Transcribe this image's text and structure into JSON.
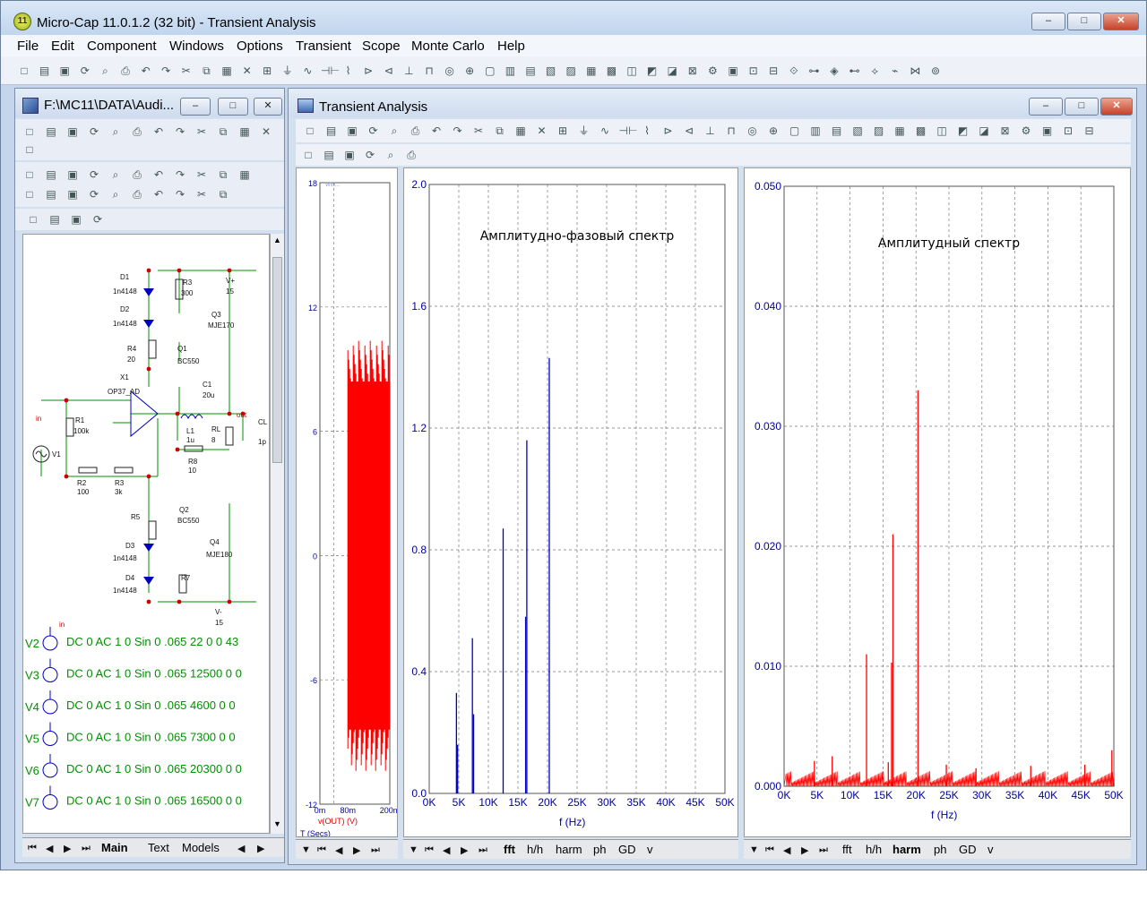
{
  "app": {
    "title": "Micro-Cap 11.0.1.2 (32 bit) - Transient Analysis",
    "icon_text": "11",
    "window_buttons": [
      "–",
      "□",
      "✕"
    ]
  },
  "menu": [
    "File",
    "Edit",
    "Component",
    "Windows",
    "Options",
    "Transient",
    "Scope",
    "Monte Carlo",
    "Help"
  ],
  "schematic_window": {
    "title": "F:\\MC11\\DATA\\Audi...",
    "components": {
      "D1": "D1",
      "D1m": "1n4148",
      "D2": "D2",
      "D2m": "1n4148",
      "R3": "R3",
      "R3v": "300",
      "Q3": "Q3",
      "Q3m": "MJE170",
      "R4": "R4",
      "R4v": "20",
      "Q1": "Q1",
      "Q1m": "BC550",
      "X1": "X1",
      "X1m": "OP37_AD",
      "C1": "C1",
      "C1v": "20u",
      "R1": "R1",
      "R1v": "100k",
      "in": "in",
      "out": "out",
      "L1": "L1",
      "L1v": "1u",
      "RL": "RL",
      "RLv": "8",
      "CL": "CL",
      "CLv": "1p",
      "V1": "V1",
      "R8": "R8",
      "R8v": "10",
      "R2": "R2",
      "R2v": "100",
      "R3b": "R3",
      "R3bv": "3k",
      "Q2": "Q2",
      "Q2m": "BC550",
      "R5": "R5",
      "D3": "D3",
      "D3m": "1n4148",
      "Q4": "Q4",
      "Q4m": "MJE180",
      "D4": "D4",
      "D4m": "1n4148",
      "R7": "R7",
      "Vp": "V+",
      "Vpv": "15",
      "Vm": "V-",
      "Vmv": "15",
      "in2": "in"
    },
    "sources": [
      {
        "name": "V2",
        "spec": "DC 0 AC 1 0 Sin 0 .065 22 0 0 43"
      },
      {
        "name": "V3",
        "spec": "DC 0 AC 1 0 Sin 0 .065 12500 0 0"
      },
      {
        "name": "V4",
        "spec": "DC 0 AC 1 0 Sin 0 .065 4600 0 0"
      },
      {
        "name": "V5",
        "spec": "DC 0 AC 1 0 Sin 0 .065 7300 0 0"
      },
      {
        "name": "V6",
        "spec": "DC 0 AC 1 0 Sin 0 .065 20300 0 0"
      },
      {
        "name": "V7",
        "spec": "DC 0 AC 1 0 Sin 0 .065 16500 0 0"
      }
    ],
    "tabs": [
      "Main",
      "Text",
      "Models"
    ],
    "active_tab": "Main"
  },
  "transient_window": {
    "title": "Transient Analysis",
    "panels": [
      {
        "tabs": []
      },
      {
        "tabs": [
          "fft",
          "h/h",
          "harm",
          "ph",
          "GD",
          "v"
        ],
        "active_tab": "fft"
      },
      {
        "tabs": [
          "fft",
          "h/h",
          "harm",
          "ph",
          "GD",
          "v"
        ],
        "active_tab": "harm"
      }
    ]
  },
  "chart_data": [
    {
      "type": "line",
      "title": "",
      "xlabel": "T (Secs)",
      "ylabel": "v(OUT) (V)",
      "x_ticks": [
        "0m",
        "80m",
        "200m"
      ],
      "y_ticks": [
        "18",
        "12",
        "6",
        "0",
        "-6",
        "-12"
      ],
      "xlim": [
        0,
        0.2
      ],
      "ylim": [
        -12,
        18
      ],
      "series": [
        {
          "color": "#ff0000",
          "envelope": {
            "x_start": 0.08,
            "x_end": 0.2,
            "min": -10.5,
            "max": 10.5
          }
        }
      ],
      "grid": true,
      "extra_label": "WW..."
    },
    {
      "type": "bar",
      "title": "Амплитудно-фазовый спектр",
      "xlabel": "f (Hz)",
      "ylabel": "",
      "x_ticks": [
        "0K",
        "5K",
        "10K",
        "15K",
        "20K",
        "25K",
        "30K",
        "35K",
        "40K",
        "45K",
        "50K"
      ],
      "y_ticks": [
        "0.0",
        "0.4",
        "0.8",
        "1.2",
        "1.6",
        "2.0"
      ],
      "xlim": [
        0,
        50000
      ],
      "ylim": [
        0,
        2.0
      ],
      "grid": true,
      "color": "#0000c0",
      "bars": [
        {
          "x": 4600,
          "y": 0.33
        },
        {
          "x": 4800,
          "y": 0.16
        },
        {
          "x": 7300,
          "y": 0.51
        },
        {
          "x": 7500,
          "y": 0.26
        },
        {
          "x": 12500,
          "y": 0.87
        },
        {
          "x": 16300,
          "y": 0.58
        },
        {
          "x": 16500,
          "y": 1.16
        },
        {
          "x": 20300,
          "y": 1.43
        }
      ]
    },
    {
      "type": "bar",
      "title": "Амплитудный спектр",
      "xlabel": "f (Hz)",
      "ylabel": "",
      "x_ticks": [
        "0K",
        "5K",
        "10K",
        "15K",
        "20K",
        "25K",
        "30K",
        "35K",
        "40K",
        "45K",
        "50K"
      ],
      "y_ticks": [
        "0.000",
        "0.010",
        "0.020",
        "0.030",
        "0.040",
        "0.050"
      ],
      "xlim": [
        0,
        50000
      ],
      "ylim": [
        0,
        0.05
      ],
      "grid": true,
      "color": "#ff0000",
      "bars": [
        {
          "x": 4600,
          "y": 0.0021
        },
        {
          "x": 7300,
          "y": 0.0025
        },
        {
          "x": 12500,
          "y": 0.011
        },
        {
          "x": 15800,
          "y": 0.002
        },
        {
          "x": 16300,
          "y": 0.0103
        },
        {
          "x": 16500,
          "y": 0.021
        },
        {
          "x": 20300,
          "y": 0.033
        },
        {
          "x": 24600,
          "y": 0.0018
        },
        {
          "x": 29100,
          "y": 0.0015
        },
        {
          "x": 37400,
          "y": 0.0017
        },
        {
          "x": 45600,
          "y": 0.0018
        },
        {
          "x": 49700,
          "y": 0.003
        }
      ],
      "noise_floor": 0.0008
    }
  ]
}
